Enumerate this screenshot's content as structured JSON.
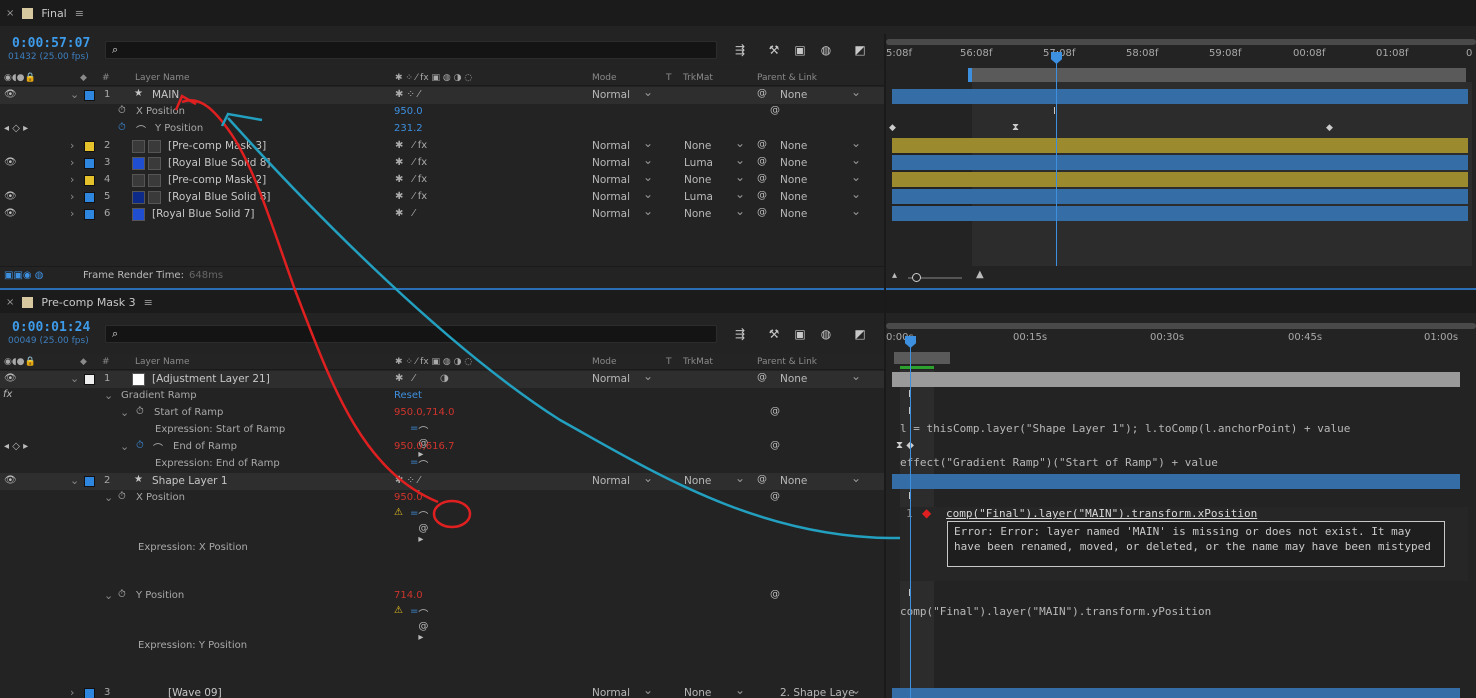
{
  "colors": {
    "accent": "#3d8fe0",
    "label_blue": "#2e86de",
    "label_yellow": "#e5c22c",
    "bar_blue": "#356ea7",
    "bar_yellow": "#9c8a2e",
    "annot_red": "#e02020",
    "annot_teal": "#23a0c0",
    "error": "#d0342c"
  },
  "top": {
    "tab_title": "Final",
    "timecode": "0:00:57:07",
    "timecode_sub": "01432 (25.00 fps)",
    "search_placeholder": "",
    "columns": {
      "layer_name": "Layer Name",
      "mode": "Mode",
      "t": "T",
      "trkmat": "TrkMat",
      "parent": "Parent & Link"
    },
    "ruler": [
      "5:08f",
      "56:08f",
      "57:08f",
      "58:08f",
      "59:08f",
      "00:08f",
      "01:08f",
      "0"
    ],
    "layers": [
      {
        "num": "1",
        "name": "MAIN",
        "mode": "Normal",
        "trkmat": "",
        "parent": "None",
        "label": "#2e86de"
      },
      {
        "prop": "X Position",
        "value": "950.0"
      },
      {
        "prop": "Y Position",
        "value": "231.2"
      },
      {
        "num": "2",
        "name": "[Pre-comp Mask 3]",
        "mode": "Normal",
        "trkmat": "None",
        "parent": "None",
        "label": "#e5c22c"
      },
      {
        "num": "3",
        "name": "[Royal Blue Solid 8]",
        "mode": "Normal",
        "trkmat": "Luma",
        "parent": "None",
        "label": "#2e86de"
      },
      {
        "num": "4",
        "name": "[Pre-comp Mask 2]",
        "mode": "Normal",
        "trkmat": "None",
        "parent": "None",
        "label": "#e5c22c"
      },
      {
        "num": "5",
        "name": "[Royal Blue Solid 8]",
        "mode": "Normal",
        "trkmat": "Luma",
        "parent": "None",
        "label": "#2e86de"
      },
      {
        "num": "6",
        "name": "[Royal Blue Solid 7]",
        "mode": "Normal",
        "trkmat": "None",
        "parent": "None",
        "label": "#2e86de"
      }
    ],
    "footer": {
      "label": "Frame Render Time:",
      "value": "648ms"
    }
  },
  "bottom": {
    "tab_title": "Pre-comp Mask 3",
    "timecode": "0:00:01:24",
    "timecode_sub": "00049 (25.00 fps)",
    "columns": {
      "layer_name": "Layer Name",
      "mode": "Mode",
      "t": "T",
      "trkmat": "TrkMat",
      "parent": "Parent & Link"
    },
    "ruler": [
      "0:00s",
      "00:15s",
      "00:30s",
      "00:45s",
      "01:00s"
    ],
    "layer1": {
      "num": "1",
      "name": "[Adjustment Layer 21]",
      "mode": "Normal",
      "parent": "None"
    },
    "effect": {
      "name": "Gradient Ramp",
      "reset": "Reset"
    },
    "start_ramp": {
      "label": "Start of Ramp",
      "value": "950.0,714.0",
      "expr_label": "Expression: Start of Ramp"
    },
    "end_ramp": {
      "label": "End of Ramp",
      "value": "950.0,616.7",
      "expr_label": "Expression: End of Ramp"
    },
    "layer2": {
      "num": "2",
      "name": "Shape Layer 1",
      "mode": "Normal",
      "trkmat": "None",
      "parent": "None"
    },
    "xpos": {
      "label": "X Position",
      "value": "950.0",
      "expr_label": "Expression: X Position"
    },
    "ypos": {
      "label": "Y Position",
      "value": "714.0",
      "expr_label": "Expression: Y Position"
    },
    "partial_row": {
      "num": "3",
      "name": "[Wave 09]",
      "mode": "Normal",
      "trkmat": "None",
      "parent": "2. Shape Laye"
    },
    "expressions": {
      "start": "l = thisComp.layer(\"Shape Layer 1\"); l.toComp(l.anchorPoint) + value",
      "end": "effect(\"Gradient Ramp\")(\"Start of Ramp\") + value",
      "x": "comp(\"Final\").layer(\"MAIN\").transform.xPosition",
      "x_line": "1",
      "error": "Error:  Error: layer named 'MAIN' is missing or does not exist. It may have been renamed, moved, or deleted, or the name may have been mistyped",
      "y": "comp(\"Final\").layer(\"MAIN\").transform.yPosition"
    }
  }
}
